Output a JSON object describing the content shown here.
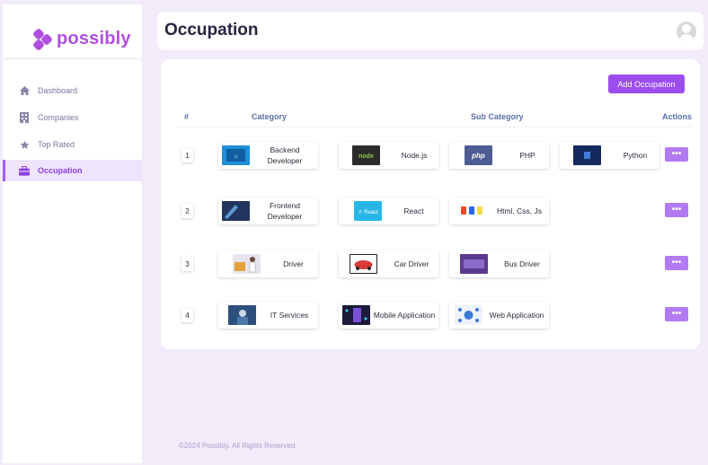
{
  "brand": {
    "name": "possibly"
  },
  "sidebar": {
    "items": [
      {
        "label": "Dashboard",
        "icon": "home-icon"
      },
      {
        "label": "Companies",
        "icon": "building-icon"
      },
      {
        "label": "Top Rated",
        "icon": "star-icon"
      },
      {
        "label": "Occupation",
        "icon": "briefcase-icon",
        "active": true
      }
    ]
  },
  "header": {
    "title": "Occupation"
  },
  "main": {
    "add_button": "Add Occupation",
    "columns": {
      "index": "#",
      "category": "Category",
      "sub_category": "Sub Category",
      "actions": "Actions"
    },
    "rows": [
      {
        "index": "1",
        "category": "Backend Developer",
        "subs": [
          "Node.js",
          "PHP",
          "Python"
        ]
      },
      {
        "index": "2",
        "category": "Frontend Developer",
        "subs": [
          "React",
          "Html, Css, Js"
        ]
      },
      {
        "index": "3",
        "category": "Driver",
        "subs": [
          "Car Driver",
          "Bus Driver"
        ]
      },
      {
        "index": "4",
        "category": "IT Services",
        "subs": [
          "Mobile Application",
          "Web Application"
        ]
      }
    ],
    "action_label": "•••"
  },
  "footer": {
    "text": "©2024 Possibly. All Rights Reserved."
  },
  "colors": {
    "accent": "#9b4dee",
    "brand": "#b04fe0",
    "action": "#b27af3"
  }
}
